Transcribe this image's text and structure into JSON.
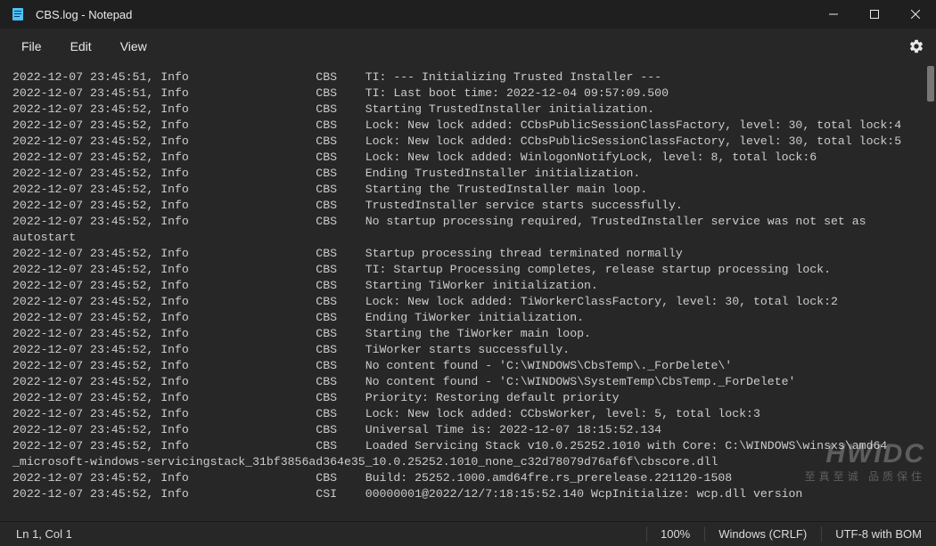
{
  "titlebar": {
    "title": "CBS.log - Notepad"
  },
  "menu": {
    "file": "File",
    "edit": "Edit",
    "view": "View"
  },
  "content": {
    "lines": [
      "2022-12-07 23:45:51, Info                  CBS    TI: --- Initializing Trusted Installer ---",
      "2022-12-07 23:45:51, Info                  CBS    TI: Last boot time: 2022-12-04 09:57:09.500",
      "2022-12-07 23:45:52, Info                  CBS    Starting TrustedInstaller initialization.",
      "2022-12-07 23:45:52, Info                  CBS    Lock: New lock added: CCbsPublicSessionClassFactory, level: 30, total lock:4",
      "2022-12-07 23:45:52, Info                  CBS    Lock: New lock added: CCbsPublicSessionClassFactory, level: 30, total lock:5",
      "2022-12-07 23:45:52, Info                  CBS    Lock: New lock added: WinlogonNotifyLock, level: 8, total lock:6",
      "2022-12-07 23:45:52, Info                  CBS    Ending TrustedInstaller initialization.",
      "2022-12-07 23:45:52, Info                  CBS    Starting the TrustedInstaller main loop.",
      "2022-12-07 23:45:52, Info                  CBS    TrustedInstaller service starts successfully.",
      "2022-12-07 23:45:52, Info                  CBS    No startup processing required, TrustedInstaller service was not set as ",
      "autostart",
      "2022-12-07 23:45:52, Info                  CBS    Startup processing thread terminated normally",
      "2022-12-07 23:45:52, Info                  CBS    TI: Startup Processing completes, release startup processing lock.",
      "2022-12-07 23:45:52, Info                  CBS    Starting TiWorker initialization.",
      "2022-12-07 23:45:52, Info                  CBS    Lock: New lock added: TiWorkerClassFactory, level: 30, total lock:2",
      "2022-12-07 23:45:52, Info                  CBS    Ending TiWorker initialization.",
      "2022-12-07 23:45:52, Info                  CBS    Starting the TiWorker main loop.",
      "2022-12-07 23:45:52, Info                  CBS    TiWorker starts successfully.",
      "2022-12-07 23:45:52, Info                  CBS    No content found - 'C:\\WINDOWS\\CbsTemp\\._ForDelete\\'",
      "2022-12-07 23:45:52, Info                  CBS    No content found - 'C:\\WINDOWS\\SystemTemp\\CbsTemp._ForDelete'",
      "2022-12-07 23:45:52, Info                  CBS    Priority: Restoring default priority",
      "2022-12-07 23:45:52, Info                  CBS    Lock: New lock added: CCbsWorker, level: 5, total lock:3",
      "2022-12-07 23:45:52, Info                  CBS    Universal Time is: 2022-12-07 18:15:52.134",
      "2022-12-07 23:45:52, Info                  CBS    Loaded Servicing Stack v10.0.25252.1010 with Core: C:\\WINDOWS\\winsxs\\amd64",
      "_microsoft-windows-servicingstack_31bf3856ad364e35_10.0.25252.1010_none_c32d78079d76af6f\\cbscore.dll",
      "2022-12-07 23:45:52, Info                  CBS    Build: 25252.1000.amd64fre.rs_prerelease.221120-1508",
      "2022-12-07 23:45:52, Info                  CSI    00000001@2022/12/7:18:15:52.140 WcpInitialize: wcp.dll version "
    ]
  },
  "status": {
    "position": "Ln 1, Col 1",
    "zoom": "100%",
    "line_ending": "Windows (CRLF)",
    "encoding": "UTF-8 with BOM"
  },
  "watermark": {
    "big": "HWIDC",
    "small": "至真至诚 品质保住"
  }
}
